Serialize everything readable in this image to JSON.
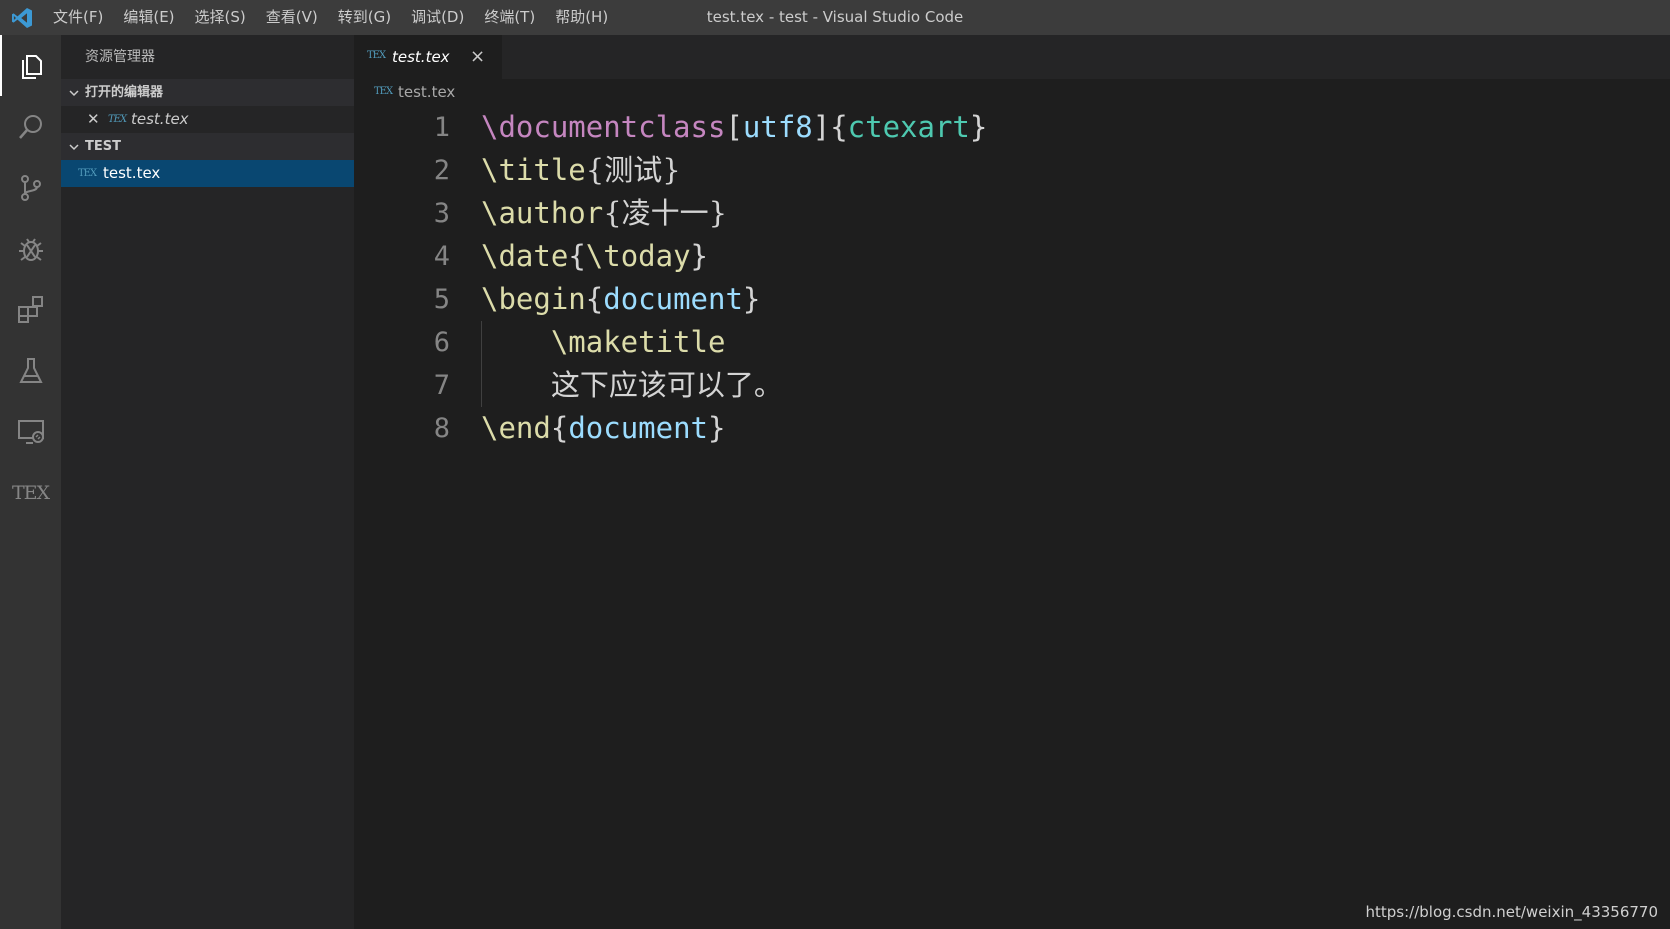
{
  "titlebar": {
    "app_icon": "vscode-icon",
    "menu": [
      "文件(F)",
      "编辑(E)",
      "选择(S)",
      "查看(V)",
      "转到(G)",
      "调试(D)",
      "终端(T)",
      "帮助(H)"
    ],
    "title": "test.tex - test - Visual Studio Code"
  },
  "activitybar": {
    "items": [
      "explorer-icon",
      "search-icon",
      "source-control-icon",
      "debug-icon",
      "extensions-icon",
      "test-icon",
      "remote-explorer-icon",
      "tex-icon"
    ],
    "tex_label": "TEX"
  },
  "sidebar": {
    "header": "资源管理器",
    "open_editors": {
      "title": "打开的编辑器",
      "files": [
        {
          "name": "test.tex",
          "icon_label": "TEX"
        }
      ]
    },
    "folder": {
      "title": "TEST",
      "files": [
        {
          "name": "test.tex",
          "icon_label": "TEX"
        }
      ]
    }
  },
  "editor": {
    "tab": {
      "name": "test.tex",
      "icon_label": "TEX",
      "close": "×"
    },
    "breadcrumb": {
      "name": "test.tex",
      "icon_label": "TEX"
    },
    "lines": [
      {
        "n": "1",
        "tokens": [
          {
            "t": "\\documentclass",
            "c": "kw"
          },
          {
            "t": "[",
            "c": "br"
          },
          {
            "t": "utf8",
            "c": "arg"
          },
          {
            "t": "]{",
            "c": "br"
          },
          {
            "t": "ctexart",
            "c": "cls"
          },
          {
            "t": "}",
            "c": "br"
          }
        ]
      },
      {
        "n": "2",
        "tokens": [
          {
            "t": "\\title",
            "c": "cmd"
          },
          {
            "t": "{测试}",
            "c": "br"
          }
        ]
      },
      {
        "n": "3",
        "tokens": [
          {
            "t": "\\author",
            "c": "cmd"
          },
          {
            "t": "{凌十一}",
            "c": "br"
          }
        ]
      },
      {
        "n": "4",
        "tokens": [
          {
            "t": "\\date",
            "c": "cmd"
          },
          {
            "t": "{",
            "c": "br"
          },
          {
            "t": "\\today",
            "c": "cmd"
          },
          {
            "t": "}",
            "c": "br"
          }
        ]
      },
      {
        "n": "5",
        "tokens": [
          {
            "t": "\\begin",
            "c": "cmd"
          },
          {
            "t": "{",
            "c": "br"
          },
          {
            "t": "document",
            "c": "arg"
          },
          {
            "t": "}",
            "c": "br"
          }
        ]
      },
      {
        "n": "6",
        "indent": true,
        "tokens": [
          {
            "t": "    ",
            "c": "br"
          },
          {
            "t": "\\maketitle",
            "c": "cmd"
          }
        ]
      },
      {
        "n": "7",
        "indent": true,
        "tokens": [
          {
            "t": "    ",
            "c": "br"
          },
          {
            "t": "这下应该可以了。",
            "c": "br"
          }
        ]
      },
      {
        "n": "8",
        "tokens": [
          {
            "t": "\\end",
            "c": "cmd"
          },
          {
            "t": "{",
            "c": "br"
          },
          {
            "t": "document",
            "c": "arg"
          },
          {
            "t": "}",
            "c": "br"
          }
        ]
      }
    ]
  },
  "watermark": "https://blog.csdn.net/weixin_43356770"
}
